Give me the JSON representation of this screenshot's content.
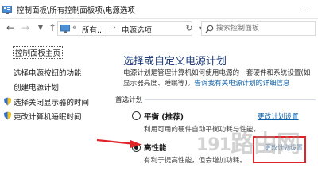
{
  "window": {
    "title": "控制面板\\所有控制面板项\\电源选项"
  },
  "nav": {
    "address_segments": [
      "所有...",
      "电源选项"
    ],
    "search_placeholder": "搜索控制面板"
  },
  "sidebar": {
    "home": "控制面板主页",
    "items": [
      {
        "label": "选择电源按钮的功能"
      },
      {
        "label": "创建电源计划"
      },
      {
        "label": "选择关闭显示器的时间"
      },
      {
        "label": "更改计算机睡眠时间"
      }
    ]
  },
  "main": {
    "title": "选择或自定义电源计划",
    "description": "电源计划是管理计算机如何使用电源的一套硬件和系统设置(如显示器亮度、睡眠等)。",
    "description_link": "告诉我有关电源计划的详细信息",
    "section_label": "首选计划",
    "plans": [
      {
        "name": "平衡 (推荐)",
        "desc": "利用可用的硬件自动平衡功耗与性能。",
        "link": "更改计划设置",
        "selected": false
      },
      {
        "name": "高性能",
        "desc": "有利于提高性能，但会增加功耗。",
        "link": "更改计划设置",
        "selected": true
      }
    ]
  },
  "watermark": {
    "digits": "191",
    "text": "路由网"
  },
  "colors": {
    "title_blue": "#1f3d7a",
    "link_blue": "#0b5fa8",
    "annotation_red": "#e0242a"
  }
}
